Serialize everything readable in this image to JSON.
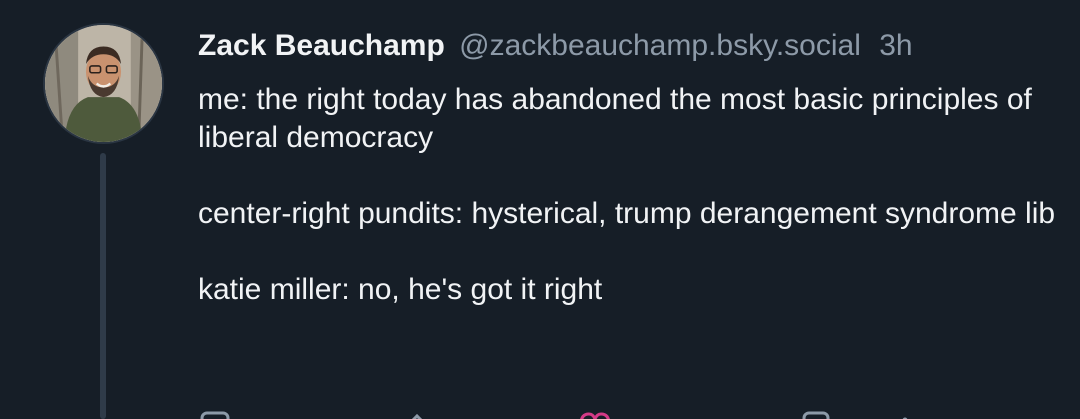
{
  "post": {
    "author": {
      "display_name": "Zack Beauchamp",
      "handle": "@zackbeauchamp.bsky.social"
    },
    "timestamp": "3h",
    "text_paragraphs": [
      "me: the right today has abandoned the most basic principles of liberal democracy",
      "center-right pundits: hysterical, trump derangement syndrome lib",
      "katie miller: no, he's got it right"
    ]
  },
  "actions": {
    "icons": [
      "reply-icon",
      "repost-icon",
      "like-icon",
      "bookmark-icon"
    ]
  },
  "colors": {
    "background": "#161e27",
    "text": "#f1f3f5",
    "muted": "#8d9aa8",
    "thread_line": "#2f3b49",
    "like": "#d43a87"
  }
}
